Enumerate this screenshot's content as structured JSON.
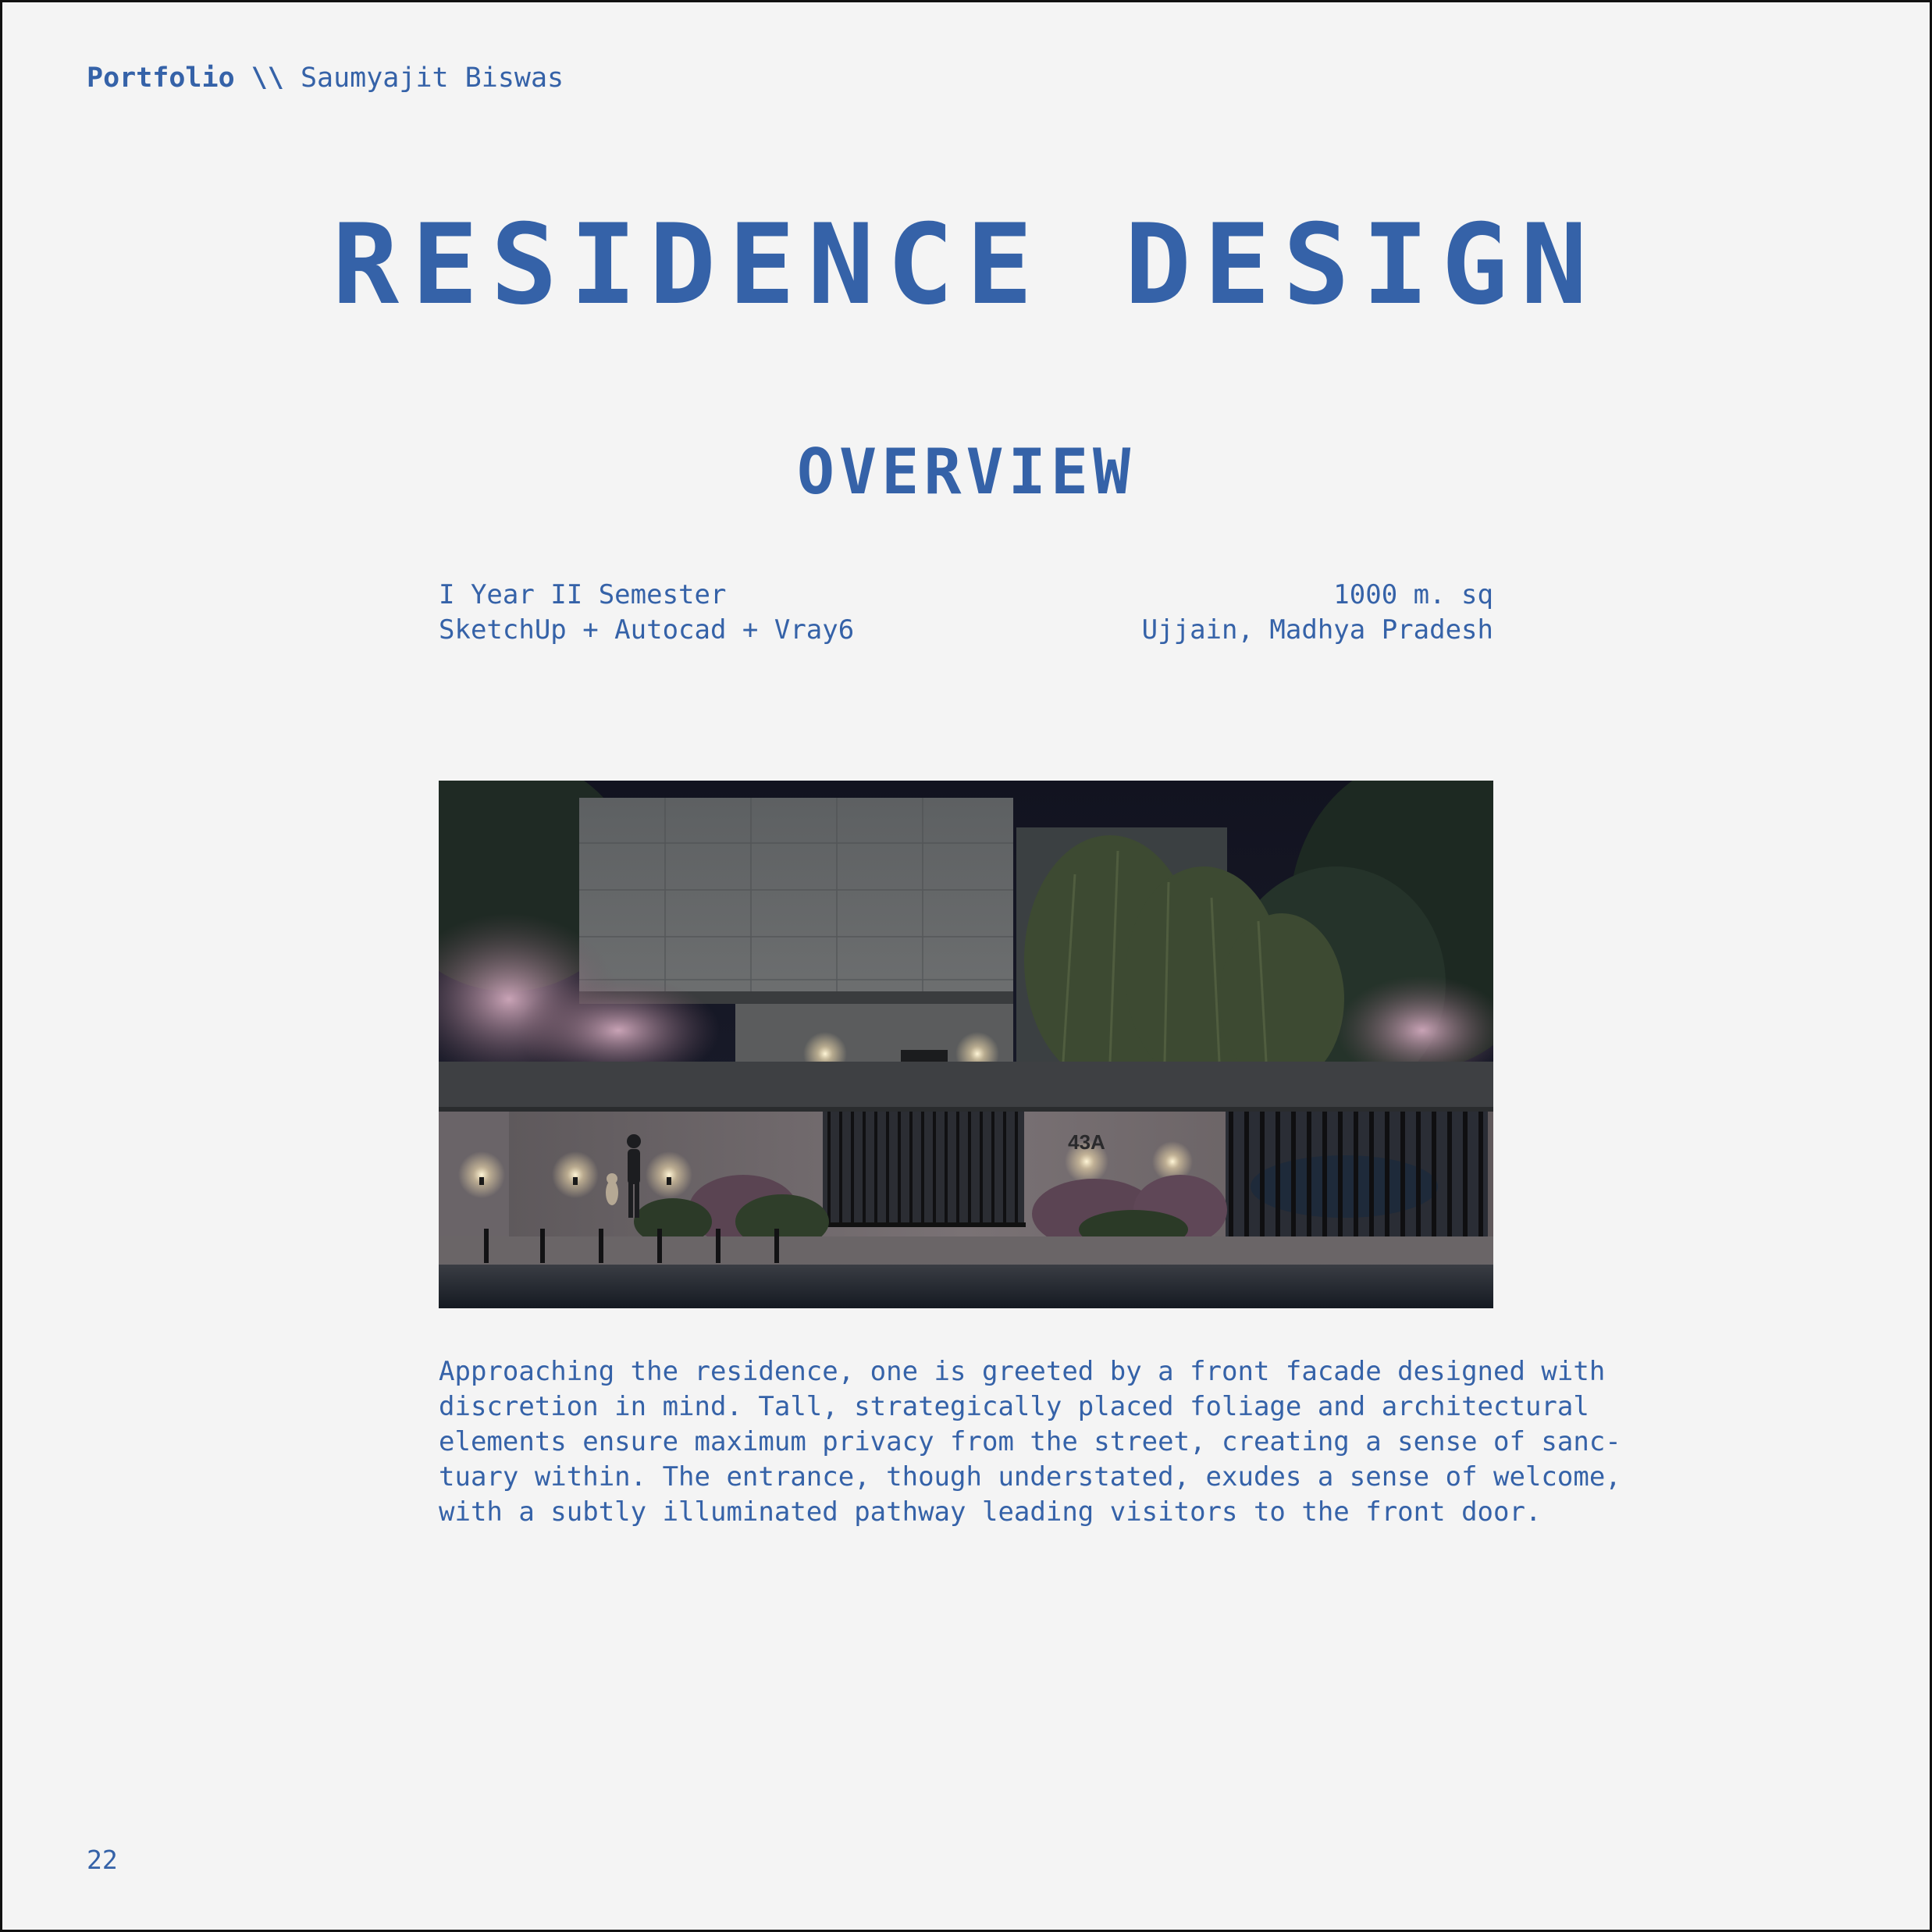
{
  "colors": {
    "accent": "#3562a8",
    "background": "#f4f4f4"
  },
  "header": {
    "brand": "Portfolio \\\\",
    "author": "Saumyajit Biswas"
  },
  "title": "RESIDENCE DESIGN",
  "subtitle": "OVERVIEW",
  "meta": {
    "year": "I Year II Semester",
    "software": "SketchUp + Autocad + Vray6",
    "area": "1000 m. sq",
    "location": "Ujjain, Madhya Pradesh"
  },
  "render": {
    "house_number": "43A"
  },
  "description": {
    "lines": [
      "Approaching the residence, one is greeted by a front facade designed with",
      "discretion in mind. Tall, strategically placed foliage and architectural",
      "elements ensure maximum privacy from the street, creating a sense of sanc-",
      "tuary within. The entrance, though understated, exudes a sense of welcome,",
      "with a subtly illuminated pathway leading visitors to the front door."
    ]
  },
  "page_number": "22"
}
